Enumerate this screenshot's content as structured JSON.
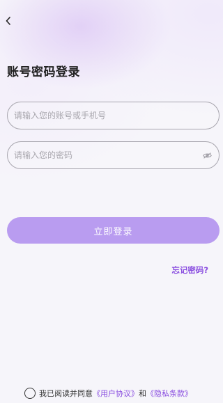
{
  "header": {
    "back_icon": "chevron-left-icon",
    "title": "账号密码登录"
  },
  "form": {
    "account_placeholder": "请输入您的账号或手机号",
    "password_placeholder": "请输入您的密码",
    "password_icon": "eye-icon",
    "login_label": "立即登录",
    "forgot_label": "忘记密码?"
  },
  "agreement": {
    "checked": false,
    "prefix": "我已阅读并同意",
    "user_agreement": "《用户协议》",
    "connector": "和",
    "privacy_policy": "《隐私条款》"
  },
  "colors": {
    "accent": "#8a4ee0",
    "button": "#b99cf0",
    "background": "#f6f5fa"
  }
}
